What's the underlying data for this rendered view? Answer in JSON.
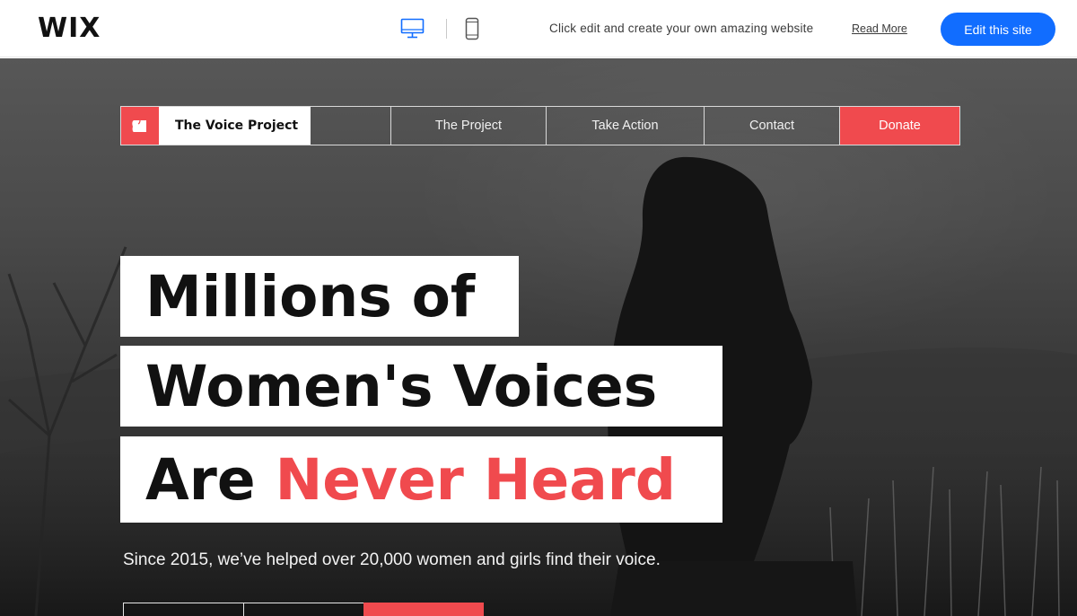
{
  "wix_bar": {
    "logo": "WIX",
    "device_switch": {
      "desktop_icon": "desktop-icon",
      "mobile_icon": "mobile-icon",
      "active": "desktop"
    },
    "promo_text": "Click edit and create your own amazing website",
    "read_more": "Read More",
    "edit_button": "Edit this site",
    "accent_color": "#116dff"
  },
  "site_nav": {
    "brand_icon": "heart-icon",
    "brand_name": "The Voice Project",
    "items": [
      {
        "label": "The Project"
      },
      {
        "label": "Take Action"
      },
      {
        "label": "Contact"
      }
    ],
    "donate": "Donate",
    "brand_color": "#f04a4e"
  },
  "hero": {
    "headline_line1": "Millions of",
    "headline_line2": "Women's Voices",
    "headline_line3_start": "Are",
    "headline_line3_highlight": "Never Heard",
    "subtext": "Since 2015, we’ve helped over 20,000 women and girls find their voice."
  }
}
